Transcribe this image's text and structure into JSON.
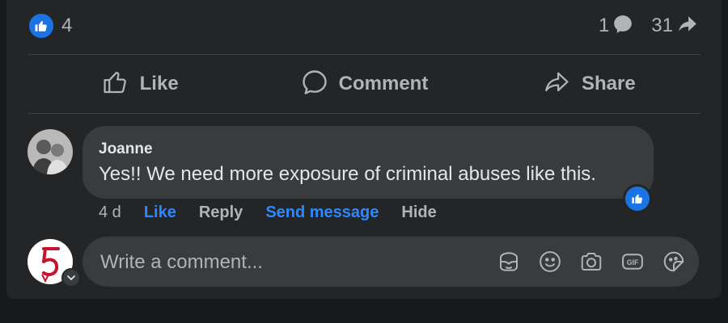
{
  "stats": {
    "reactions_count": "4",
    "comments_count": "1",
    "shares_count": "31"
  },
  "actions": {
    "like_label": "Like",
    "comment_label": "Comment",
    "share_label": "Share"
  },
  "comment": {
    "author": "Joanne",
    "text": "Yes!! We need more exposure of criminal abuses like this.",
    "time": "4 d",
    "like_label": "Like",
    "reply_label": "Reply",
    "send_message_label": "Send message",
    "hide_label": "Hide"
  },
  "composer": {
    "placeholder": "Write a comment..."
  },
  "icons": {
    "reaction": "thumbs-up-icon",
    "comments": "comment-bubble-icon",
    "shares": "share-arrow-icon",
    "composer_tools": [
      "avatar-sticker-icon",
      "emoji-icon",
      "camera-icon",
      "gif-icon",
      "sticker-icon"
    ]
  },
  "colors": {
    "accent": "#1b74e4",
    "link": "#2d88ff",
    "card": "#242526",
    "bubble": "#3a3b3c"
  }
}
